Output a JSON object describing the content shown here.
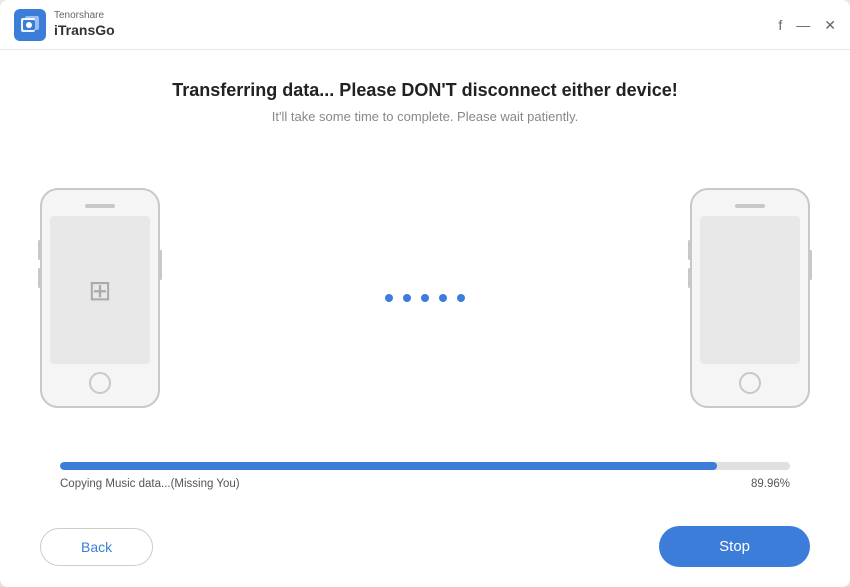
{
  "app": {
    "brand": "Tenorshare",
    "title": "iTransGo",
    "logo_color": "#3b7dd8"
  },
  "window_controls": {
    "facebook": "f",
    "minimize": "—",
    "close": "✕"
  },
  "main": {
    "heading": "Transferring data... Please DON'T disconnect either device!",
    "subheading": "It'll take some time to complete. Please wait patiently."
  },
  "transfer": {
    "dots_count": 5
  },
  "progress": {
    "fill_percent": 89.96,
    "status_text": "Copying Music data...(Missing You)",
    "percent_label": "89.96%"
  },
  "footer": {
    "back_label": "Back",
    "stop_label": "Stop"
  }
}
